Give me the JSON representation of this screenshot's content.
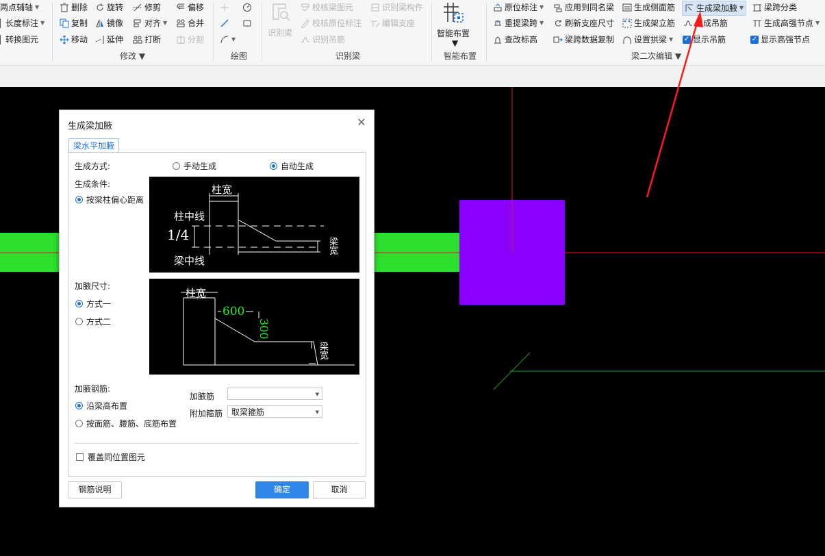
{
  "ribbon": {
    "axis_group": {
      "two_point_axis": "两点辅轴",
      "length_label": "长度标注",
      "convert_element": "转换图元"
    },
    "modify_group": {
      "label": "修改",
      "delete": "删除",
      "rotate": "旋转",
      "trim": "修剪",
      "offset": "偏移",
      "copy": "复制",
      "mirror": "镜像",
      "align": "对齐",
      "merge": "合并",
      "move": "移动",
      "extend": "延伸",
      "break": "打断",
      "split": "分割"
    },
    "draw_group": {
      "label": "绘图"
    },
    "identify_group": {
      "label": "识别梁",
      "identify_beam": "识别梁",
      "check_beam_drawing": "校核梁图元",
      "check_original_label": "校核原位标注",
      "identify_hanger": "识别吊筋",
      "identify_beam_member": "识别梁构件",
      "edit_support": "编辑支座"
    },
    "smart_group": {
      "label": "智能布置",
      "button": "智能布置"
    },
    "beam_edit_group": {
      "label": "梁二次编辑",
      "original_label": "原位标注",
      "apply_same_name": "应用到同名梁",
      "gen_side_bar": "生成侧面筋",
      "gen_haunch": "生成梁加腋",
      "span_classify": "梁跨分类",
      "re_extract_span": "重提梁跨",
      "refresh_support": "刷新支座尺寸",
      "gen_erect_bar": "生成架立筋",
      "gen_hanger": "生成吊筋",
      "gen_high_strength_node": "生成高强节点",
      "check_elevation": "查改标高",
      "span_data_copy": "梁跨数据复制",
      "set_arch_beam": "设置拱梁",
      "show_hanger": "显示吊筋",
      "show_high_strength_node": "显示高强节点"
    }
  },
  "dialog": {
    "title": "生成梁加腋",
    "tab": "梁水平加腋",
    "gen_mode_label": "生成方式:",
    "manual_option": "手动生成",
    "auto_option": "自动生成",
    "condition_label": "生成条件:",
    "condition_option": "按梁柱偏心距离",
    "size_label": "加腋尺寸:",
    "size_option1": "方式一",
    "size_option2": "方式二",
    "rebar_label": "加腋钢筋:",
    "rebar_option1": "沿梁高布置",
    "rebar_option2": "按面筋、腰筋、底筋布置",
    "haunch_bar_label": "加腋筋",
    "haunch_bar_value": "",
    "extra_stirrup_label": "附加箍筋",
    "extra_stirrup_value": "取梁箍筋",
    "override_checkbox": "覆盖同位置图元",
    "rebar_help_button": "钢筋说明",
    "ok_button": "确定",
    "cancel_button": "取消",
    "diagram1": {
      "col_width": "柱宽",
      "col_center": "柱中线",
      "quarter": "1/4",
      "beam_center": "梁中线",
      "beam_width": "梁宽"
    },
    "diagram2": {
      "col_width": "柱宽",
      "dim_600": "600",
      "dim_300": "300",
      "beam_width": "梁宽"
    }
  },
  "colors": {
    "accent": "#1e6fd9",
    "beam_green": "#2ee02e",
    "column_purple": "#8a00ff",
    "axis_red": "#e0142a"
  }
}
